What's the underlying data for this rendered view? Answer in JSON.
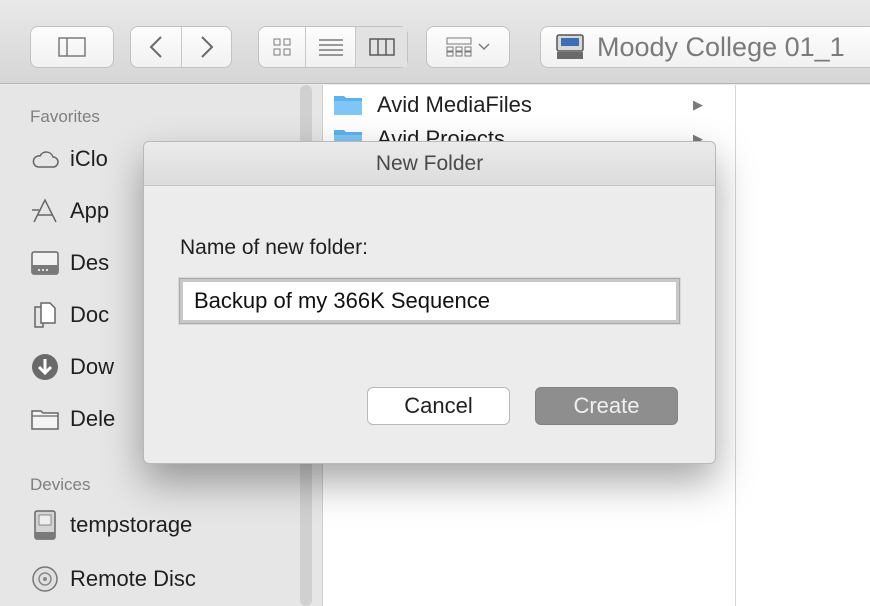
{
  "toolbar": {
    "location_label": "Moody College 01_1"
  },
  "sidebar": {
    "favorites_heading": "Favorites",
    "favorites": [
      {
        "label": "iClo",
        "icon": "cloud-icon"
      },
      {
        "label": "App",
        "icon": "applications-icon"
      },
      {
        "label": "Des",
        "icon": "desktop-icon"
      },
      {
        "label": "Doc",
        "icon": "document-icon"
      },
      {
        "label": "Dow",
        "icon": "download-icon"
      },
      {
        "label": "Dele",
        "icon": "folder-icon"
      }
    ],
    "devices_heading": "Devices",
    "devices": [
      {
        "label": "tempstorage",
        "icon": "disk-icon"
      },
      {
        "label": "Remote Disc",
        "icon": "disc-icon"
      }
    ]
  },
  "columns": {
    "items": [
      {
        "label": "Avid MediaFiles"
      },
      {
        "label": "Avid Projects"
      }
    ]
  },
  "dialog": {
    "title": "New Folder",
    "prompt": "Name of new folder:",
    "folder_name_value": "Backup of my 366K Sequence",
    "cancel_label": "Cancel",
    "create_label": "Create"
  },
  "colors": {
    "folder_blue": "#5ab3ee",
    "create_button": "#8e8e8e"
  }
}
